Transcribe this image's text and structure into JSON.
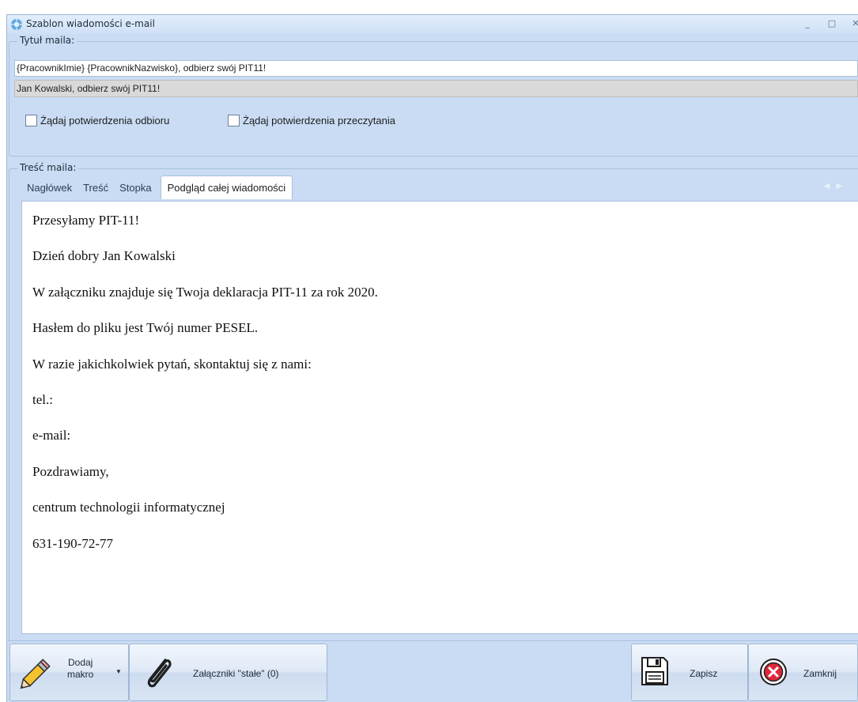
{
  "window": {
    "title": "Szablon wiadomości e-mail",
    "buttons": [
      "_",
      "□",
      "✕"
    ]
  },
  "subject_group": {
    "legend": "Tytuł maila:",
    "subject_value": "{PracownikImie} {PracownikNazwisko}, odbierz swój PIT11!",
    "subject_preview": "Jan Kowalski, odbierz swój PIT11!",
    "checkboxes": [
      {
        "label": "Żądaj potwierdzenia odbioru",
        "checked": false
      },
      {
        "label": "Żądaj potwierdzenia przeczytania",
        "checked": false
      }
    ]
  },
  "body_group": {
    "legend": "Treść maila:",
    "tabs": [
      "Nagłówek",
      "Treść",
      "Stopka",
      "Podgląd całej wiadomości"
    ],
    "active_tab": "Podgląd całej wiadomości",
    "preview_lines": [
      "Przesyłamy PIT-11!",
      "Dzień dobry Jan Kowalski",
      "W załączniku znajduje się Twoja deklaracja PIT-11 za rok 2020.",
      "Hasłem do pliku jest Twój numer PESEL.",
      "W razie jakichkolwiek pytań, skontaktuj się z nami:",
      "tel.:",
      "e-mail:",
      "Pozdrawiamy,",
      "centrum technologii informatycznej",
      "631-190-72-77"
    ]
  },
  "toolbar": {
    "add_macro_line1": "Dodaj",
    "add_macro_line2": "makro",
    "attachments_label": "Załączniki \"stałe\" (0)",
    "save_label": "Zapisz",
    "close_label": "Zamknij"
  },
  "colors": {
    "window_bg": "#c9dcf3",
    "border": "#a8c0de",
    "close_icon_red": "#e0263a"
  }
}
